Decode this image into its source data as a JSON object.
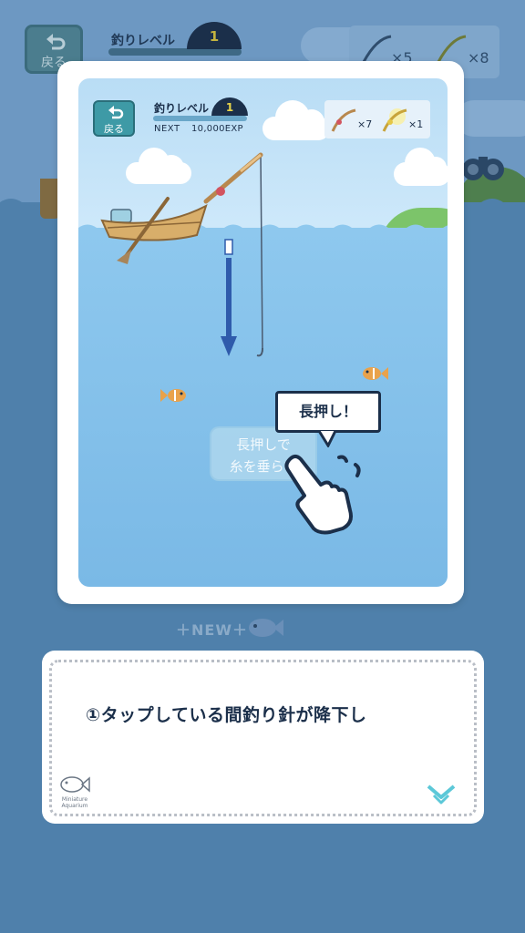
{
  "background": {
    "back_label": "戻る",
    "level_label": "釣りレベル",
    "level_value": "1",
    "rod_counts": [
      "×5",
      "×8"
    ],
    "new_label": "＋NEW＋"
  },
  "modal": {
    "back_label": "戻る",
    "level_label": "釣りレベル",
    "level_value": "1",
    "next_label": "NEXT",
    "next_exp": "10,000EXP",
    "rod_counts": [
      "×7",
      "×1"
    ],
    "tap_hint_line1": "長押しで",
    "tap_hint_line2": "糸を垂らす",
    "bubble_text": "長押し！"
  },
  "dialog": {
    "text": "①タップしている間釣り針が降下し",
    "logo_line1": "Miniature",
    "logo_line2": "Aquarium",
    "next_icon": "chevron-down-icon"
  },
  "icons": [
    "back-arrow-icon",
    "fishing-rod-icon",
    "golden-rod-icon",
    "binoculars-icon",
    "fish-icon",
    "hand-pointer-icon"
  ],
  "colors": {
    "accent_teal": "#3e9aa6",
    "navy": "#1b2f4a",
    "level_number": "#e9d54a",
    "next_chevron": "#5cc8d8"
  }
}
